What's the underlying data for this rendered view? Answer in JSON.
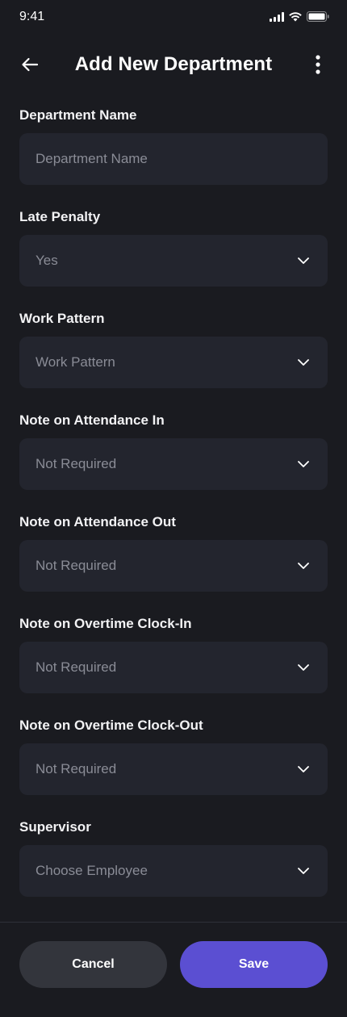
{
  "status_bar": {
    "time": "9:41",
    "icons": [
      "signal-icon",
      "wifi-icon",
      "battery-icon"
    ]
  },
  "header": {
    "title": "Add New Department",
    "back_icon": "arrow-left-icon",
    "more_icon": "more-vertical-icon"
  },
  "fields": [
    {
      "label": "Department Name",
      "value": "Department Name",
      "type": "input"
    },
    {
      "label": "Late Penalty",
      "value": "Yes",
      "type": "select"
    },
    {
      "label": "Work Pattern",
      "value": "Work Pattern",
      "type": "select"
    },
    {
      "label": "Note on Attendance In",
      "value": "Not Required",
      "type": "select"
    },
    {
      "label": "Note on Attendance Out",
      "value": "Not Required",
      "type": "select"
    },
    {
      "label": "Note on Overtime Clock-In",
      "value": "Not Required",
      "type": "select"
    },
    {
      "label": "Note on Overtime Clock-Out",
      "value": "Not Required",
      "type": "select"
    },
    {
      "label": "Supervisor",
      "value": "Choose Employee",
      "type": "select"
    }
  ],
  "footer": {
    "cancel_label": "Cancel",
    "save_label": "Save"
  },
  "colors": {
    "background": "#1a1b20",
    "field_bg": "#23252e",
    "primary": "#5b4fd2",
    "secondary_button": "#33353c"
  }
}
